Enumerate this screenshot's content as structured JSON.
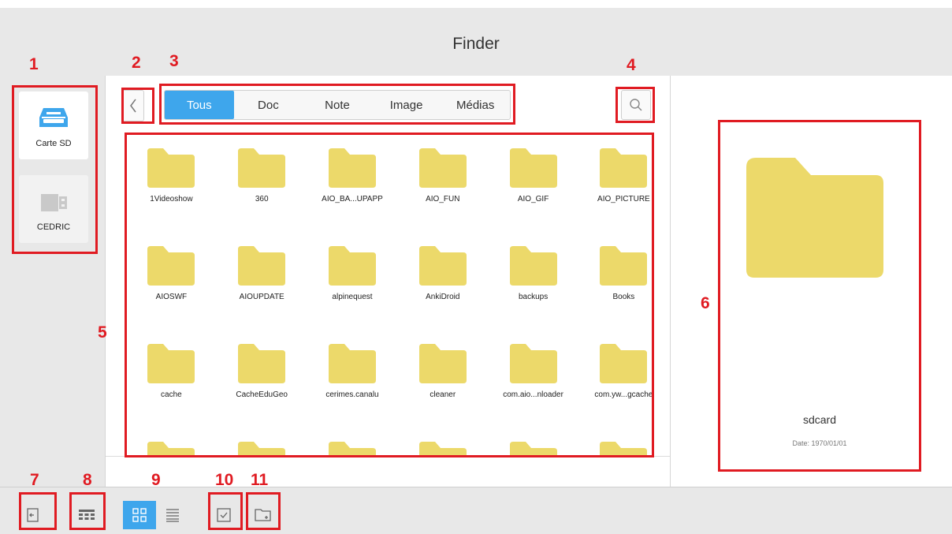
{
  "window": {
    "title": "Finder"
  },
  "devices": [
    {
      "label": "Carte SD",
      "icon": "sd-card-icon",
      "selected": true
    },
    {
      "label": "CEDRIC",
      "icon": "usb-drive-icon",
      "selected": false
    }
  ],
  "tabs": [
    {
      "label": "Tous",
      "active": true
    },
    {
      "label": "Doc",
      "active": false
    },
    {
      "label": "Note",
      "active": false
    },
    {
      "label": "Image",
      "active": false
    },
    {
      "label": "Médias",
      "active": false
    }
  ],
  "folders": [
    "1Videoshow",
    "360",
    "AIO_BA...UPAPP",
    "AIO_FUN",
    "AIO_GIF",
    "AIO_PICTURE",
    "AIOSWF",
    "AIOUPDATE",
    "alpinequest",
    "AnkiDroid",
    "backups",
    "Books",
    "cache",
    "CacheEduGeo",
    "cerimes.canalu",
    "cleaner",
    "com.aio...nloader",
    "com.yw...gcache",
    "",
    "",
    "",
    "",
    "",
    ""
  ],
  "detail": {
    "name": "sdcard",
    "date": "Date: 1970/01/01"
  },
  "annotations": {
    "n1": "1",
    "n2": "2",
    "n3": "3",
    "n4": "4",
    "n5": "5",
    "n6": "6",
    "n7": "7",
    "n8": "8",
    "n9": "9",
    "n10": "10",
    "n11": "11"
  },
  "colors": {
    "accent": "#3ea6ec",
    "folder": "#ecd96a",
    "annotation_red": "#e01b22",
    "panel_gray": "#e8e8e8"
  },
  "toolbar_icons": [
    "exit-icon",
    "storage-grid-icon",
    "grid-view-icon",
    "list-view-icon",
    "select-checkbox-icon",
    "new-folder-icon"
  ]
}
